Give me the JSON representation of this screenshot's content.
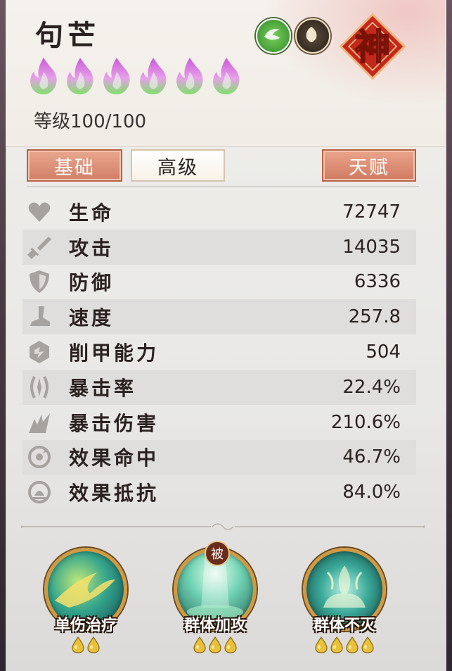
{
  "hero": {
    "name": "句芒",
    "level_label": "等级",
    "level_value": "100/100",
    "stars": 6,
    "rank_badge": "神"
  },
  "tabs": {
    "basic": "基础",
    "advanced": "高级",
    "talent": "天赋",
    "active": "advanced"
  },
  "stats": [
    {
      "label": "生命",
      "value": "72747",
      "icon": "heart-icon"
    },
    {
      "label": "攻击",
      "value": "14035",
      "icon": "sword-icon"
    },
    {
      "label": "防御",
      "value": "6336",
      "icon": "shield-icon"
    },
    {
      "label": "速度",
      "value": "257.8",
      "icon": "boot-icon"
    },
    {
      "label": "削甲能力",
      "value": "504",
      "icon": "armor-break-icon"
    },
    {
      "label": "暴击率",
      "value": "22.4%",
      "icon": "crit-rate-icon"
    },
    {
      "label": "暴击伤害",
      "value": "210.6%",
      "icon": "crit-damage-icon"
    },
    {
      "label": "效果命中",
      "value": "46.7%",
      "icon": "target-icon"
    },
    {
      "label": "效果抵抗",
      "value": "84.0%",
      "icon": "resist-icon"
    }
  ],
  "skills": [
    {
      "name": "单伤治疗",
      "level": 2,
      "passive": ""
    },
    {
      "name": "群体加攻",
      "level": 3,
      "passive": "被"
    },
    {
      "name": "群体不灭",
      "level": 4,
      "passive": ""
    }
  ],
  "colors": {
    "accent": "#d27e66",
    "flame_top": "#c95ad8",
    "flame_bottom": "#7fe06a",
    "gold": "#e8c03a"
  }
}
